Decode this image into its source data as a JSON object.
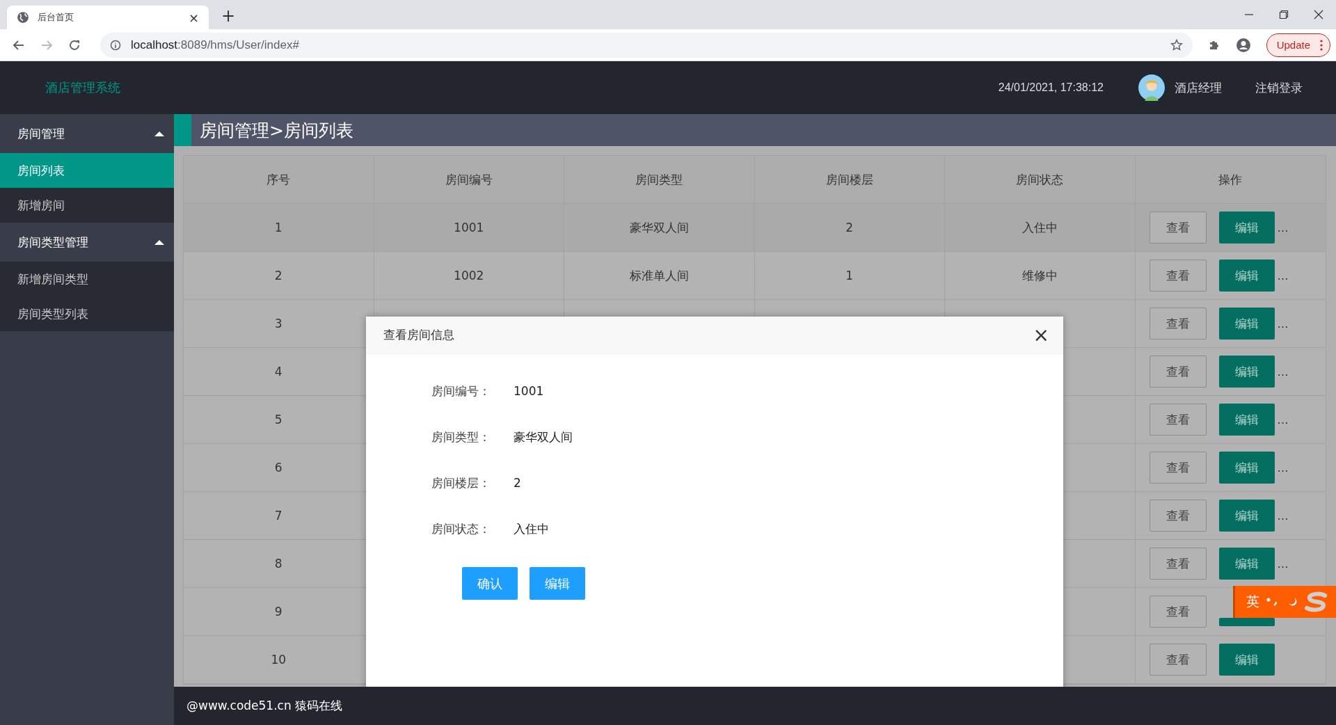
{
  "browser": {
    "tab_title": "后台首页",
    "tab_close": "×",
    "new_tab": "+",
    "url_host": "localhost",
    "url_rest": ":8089/hms/User/index#",
    "update_button": "Update"
  },
  "header": {
    "brand": "酒店管理系统",
    "datetime": "24/01/2021, 17:38:12",
    "user": "酒店经理",
    "logout": "注销登录"
  },
  "sidebar": {
    "groups": [
      {
        "label": "房间管理",
        "expanded": true,
        "items": [
          {
            "label": "房间列表",
            "selected": true
          },
          {
            "label": "新增房间",
            "selected": false
          }
        ]
      },
      {
        "label": "房间类型管理",
        "expanded": true,
        "items": [
          {
            "label": "新增房间类型",
            "selected": false
          },
          {
            "label": "房间类型列表",
            "selected": false
          }
        ]
      }
    ]
  },
  "breadcrumb": "房间管理>房间列表",
  "table": {
    "columns": [
      "序号",
      "房间编号",
      "房间类型",
      "房间楼层",
      "房间状态",
      "操作"
    ],
    "rows": [
      {
        "cells": [
          "1",
          "1001",
          "豪华双人间",
          "2",
          "入住中"
        ],
        "view": "查看",
        "edit": "编辑",
        "more": "…"
      },
      {
        "cells": [
          "2",
          "1002",
          "标准单人间",
          "1",
          "维修中"
        ],
        "view": "查看",
        "edit": "编辑",
        "more": "…"
      },
      {
        "cells": [
          "3"
        ],
        "view": "查看",
        "edit": "编辑",
        "more": "…"
      },
      {
        "cells": [
          "4"
        ],
        "view": "查看",
        "edit": "编辑",
        "more": "…"
      },
      {
        "cells": [
          "5"
        ],
        "view": "查看",
        "edit": "编辑",
        "more": "…"
      },
      {
        "cells": [
          "6"
        ],
        "view": "查看",
        "edit": "编辑",
        "more": "…"
      },
      {
        "cells": [
          "7"
        ],
        "view": "查看",
        "edit": "编辑",
        "more": "…"
      },
      {
        "cells": [
          "8"
        ],
        "view": "查看",
        "edit": "编辑",
        "more": "…"
      },
      {
        "cells": [
          "9"
        ],
        "view": "查看"
      },
      {
        "cells": [
          "10"
        ],
        "view": "查看",
        "edit": "编辑"
      }
    ]
  },
  "dialog": {
    "title": "查看房间信息",
    "close": "×",
    "fields": [
      {
        "label": "房间编号：",
        "value": "1001"
      },
      {
        "label": "房间类型：",
        "value": "豪华双人间"
      },
      {
        "label": "房间楼层：",
        "value": "2"
      },
      {
        "label": "房间状态：",
        "value": "入住中"
      }
    ],
    "buttons": [
      "确认",
      "编辑"
    ]
  },
  "ime": {
    "mode": "英"
  },
  "footer": "@www.code51.cn 猿码在线"
}
